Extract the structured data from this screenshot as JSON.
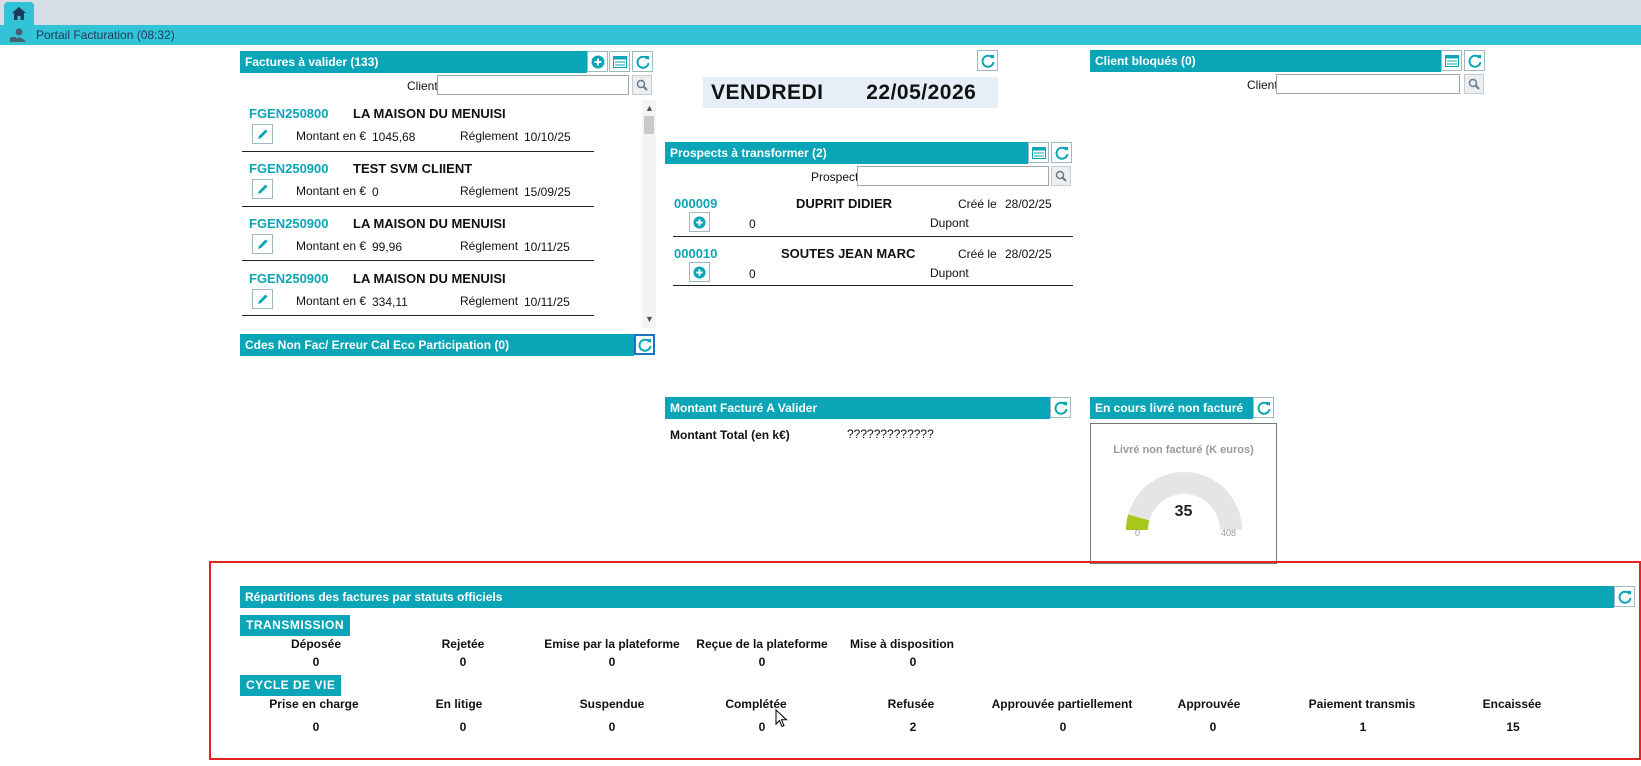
{
  "app": {
    "title": "Portail Facturation (08:32)"
  },
  "factures": {
    "header": "Factures à valider  (133)",
    "client_label": "Client",
    "client_value": "",
    "rows": [
      {
        "id": "FGEN250800",
        "client": "LA MAISON DU MENUISI",
        "montant_label": "Montant en €",
        "montant": "1045,68",
        "reglement_label": "Réglement",
        "date": "10/10/25"
      },
      {
        "id": "FGEN250900",
        "client": "TEST SVM CLIIENT",
        "montant_label": "Montant en €",
        "montant": "0",
        "reglement_label": "Réglement",
        "date": "15/09/25"
      },
      {
        "id": "FGEN250900",
        "client": "LA MAISON DU MENUISI",
        "montant_label": "Montant en €",
        "montant": "99,96",
        "reglement_label": "Réglement",
        "date": "10/11/25"
      },
      {
        "id": "FGEN250900",
        "client": "LA MAISON DU MENUISI",
        "montant_label": "Montant en €",
        "montant": "334,11",
        "reglement_label": "Réglement",
        "date": "10/11/25"
      }
    ]
  },
  "cdes": {
    "header": "Cdes Non Fac/ Erreur Cal Eco Participation  (0)"
  },
  "date": {
    "day": "VENDREDI",
    "date": "22/05/2026"
  },
  "prospects": {
    "header": "Prospects à transformer  (2)",
    "prospect_label": "Prospect",
    "prospect_value": "",
    "rows": [
      {
        "id": "000009",
        "name": "DUPRIT DIDIER",
        "cree_label": "Créé le",
        "date": "28/02/25",
        "value": "0",
        "owner": "Dupont"
      },
      {
        "id": "000010",
        "name": "SOUTES JEAN MARC",
        "cree_label": "Créé le",
        "date": "28/02/25",
        "value": "0",
        "owner": "Dupont"
      }
    ]
  },
  "clients_bloques": {
    "header": "Client bloqués  (0)",
    "client_label": "Client",
    "client_value": ""
  },
  "montant_facture": {
    "header": "Montant Facturé A Valider",
    "total_label": "Montant Total (en k€)",
    "total_value": "?????????????"
  },
  "en_cours": {
    "header": "En cours livré non facturé",
    "gauge_title": "Livré non facturé (K euros)",
    "value": 35,
    "min": "0",
    "max": "408",
    "value_text": "35",
    "fill_color": "#a8c71c",
    "track_color": "#e5e5e5"
  },
  "repartition": {
    "header": "Répartitions des factures par statuts officiels",
    "transmission": {
      "tag": "TRANSMISSION",
      "items": [
        {
          "label": "Déposée",
          "value": "0"
        },
        {
          "label": "Rejetée",
          "value": "0"
        },
        {
          "label": "Emise par la plateforme",
          "value": "0"
        },
        {
          "label": "Reçue de la plateforme",
          "value": "0"
        },
        {
          "label": "Mise à disposition",
          "value": "0"
        }
      ]
    },
    "cycle": {
      "tag": "CYCLE DE VIE",
      "items": [
        {
          "label": "Prise en charge",
          "value": "0"
        },
        {
          "label": "En litige",
          "value": "0"
        },
        {
          "label": "Suspendue",
          "value": "0"
        },
        {
          "label": "Complétée",
          "value": "0"
        },
        {
          "label": "Refusée",
          "value": "2"
        },
        {
          "label": "Approuvée partiellement",
          "value": "0"
        },
        {
          "label": "Approuvée",
          "value": "0"
        },
        {
          "label": "Paiement transmis",
          "value": "1"
        },
        {
          "label": "Encaissée",
          "value": "15"
        }
      ]
    }
  },
  "colors": {
    "teal": "#0aa5b6",
    "titlebar": "#33c3d6",
    "highlight": "#e52323"
  },
  "icons": [
    "home-icon",
    "user-icon",
    "plus-circle-icon",
    "list-icon",
    "refresh-icon",
    "search-icon",
    "pencil-icon",
    "mouse-cursor-icon"
  ]
}
